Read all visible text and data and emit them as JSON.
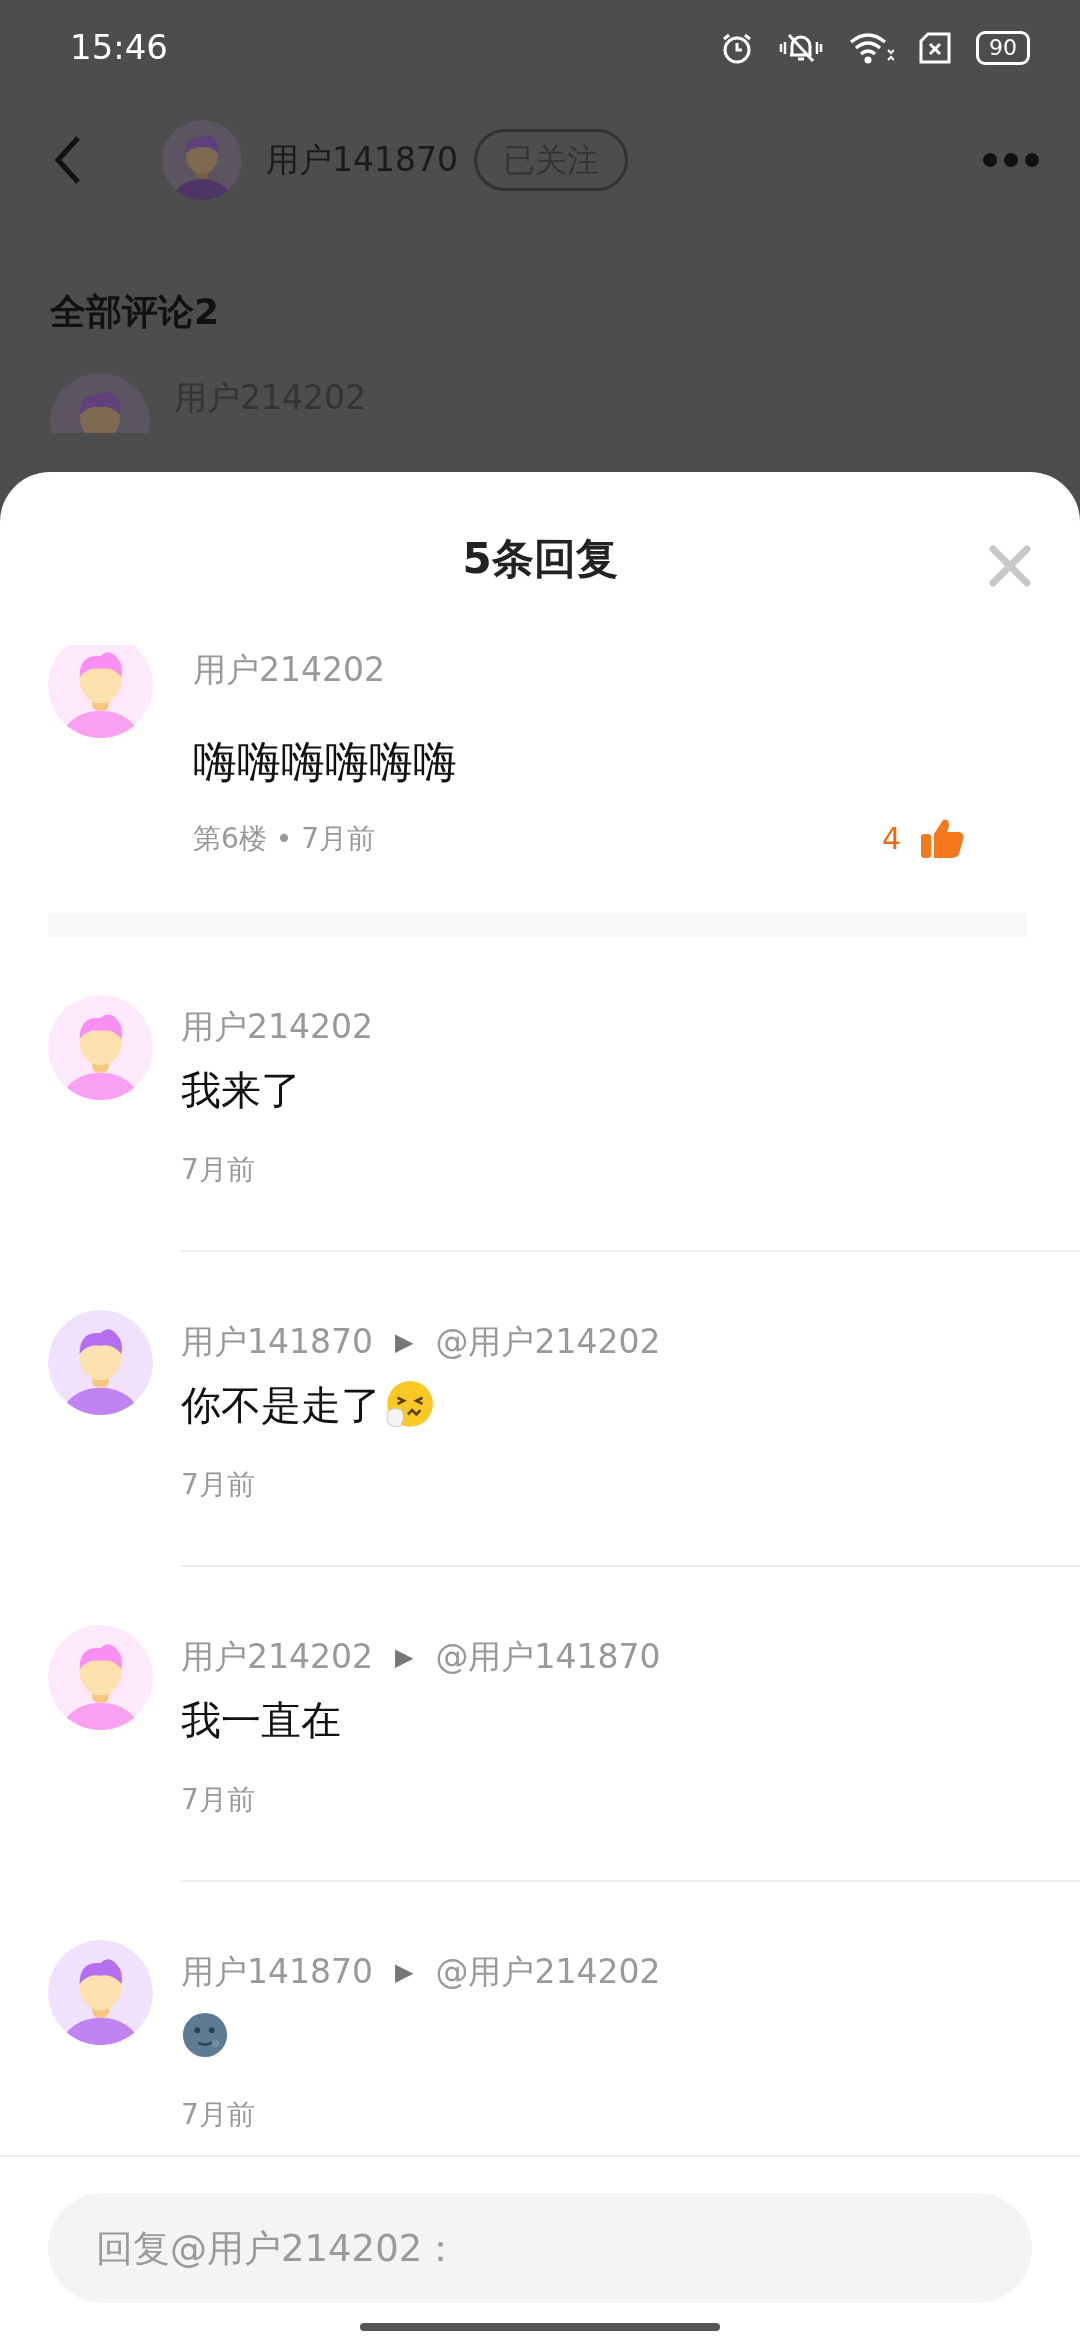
{
  "status_bar": {
    "time": "15:46",
    "battery": "90"
  },
  "header": {
    "user": "用户141870",
    "follow": "已关注",
    "avatar": {
      "color": "#5f3f7c"
    }
  },
  "section_title": "全部评论2",
  "background_comment": {
    "user": "用户214202",
    "avatar": {
      "color": "#5f3f7c"
    }
  },
  "sheet": {
    "title": "5条回复"
  },
  "comment": {
    "user": "用户214202",
    "avatar": {
      "color": "#f98ff0"
    },
    "text": "嗨嗨嗨嗨嗨嗨",
    "meta": "第6楼 • 7月前",
    "likes": "4",
    "liked": true
  },
  "replies": [
    {
      "kind": "text",
      "user": "用户214202",
      "avatar": {
        "color": "#f98ff0"
      },
      "text": "我来了",
      "time": "7月前"
    },
    {
      "kind": "sneeze",
      "user": "用户141870",
      "avatar": {
        "color": "#b56ef0"
      },
      "separator": "▶",
      "to": "@用户214202",
      "text": "你不是走了",
      "time": "7月前"
    },
    {
      "kind": "text",
      "user": "用户214202",
      "avatar": {
        "color": "#f98ff0"
      },
      "separator": "▶",
      "to": "@用户141870",
      "text": "我一直在",
      "time": "7月前"
    },
    {
      "kind": "moon",
      "user": "用户141870",
      "avatar": {
        "color": "#b56ef0"
      },
      "separator": "▶",
      "to": "@用户214202",
      "time": "7月前"
    }
  ],
  "reply_box": {
    "placeholder": "回复@用户214202："
  }
}
